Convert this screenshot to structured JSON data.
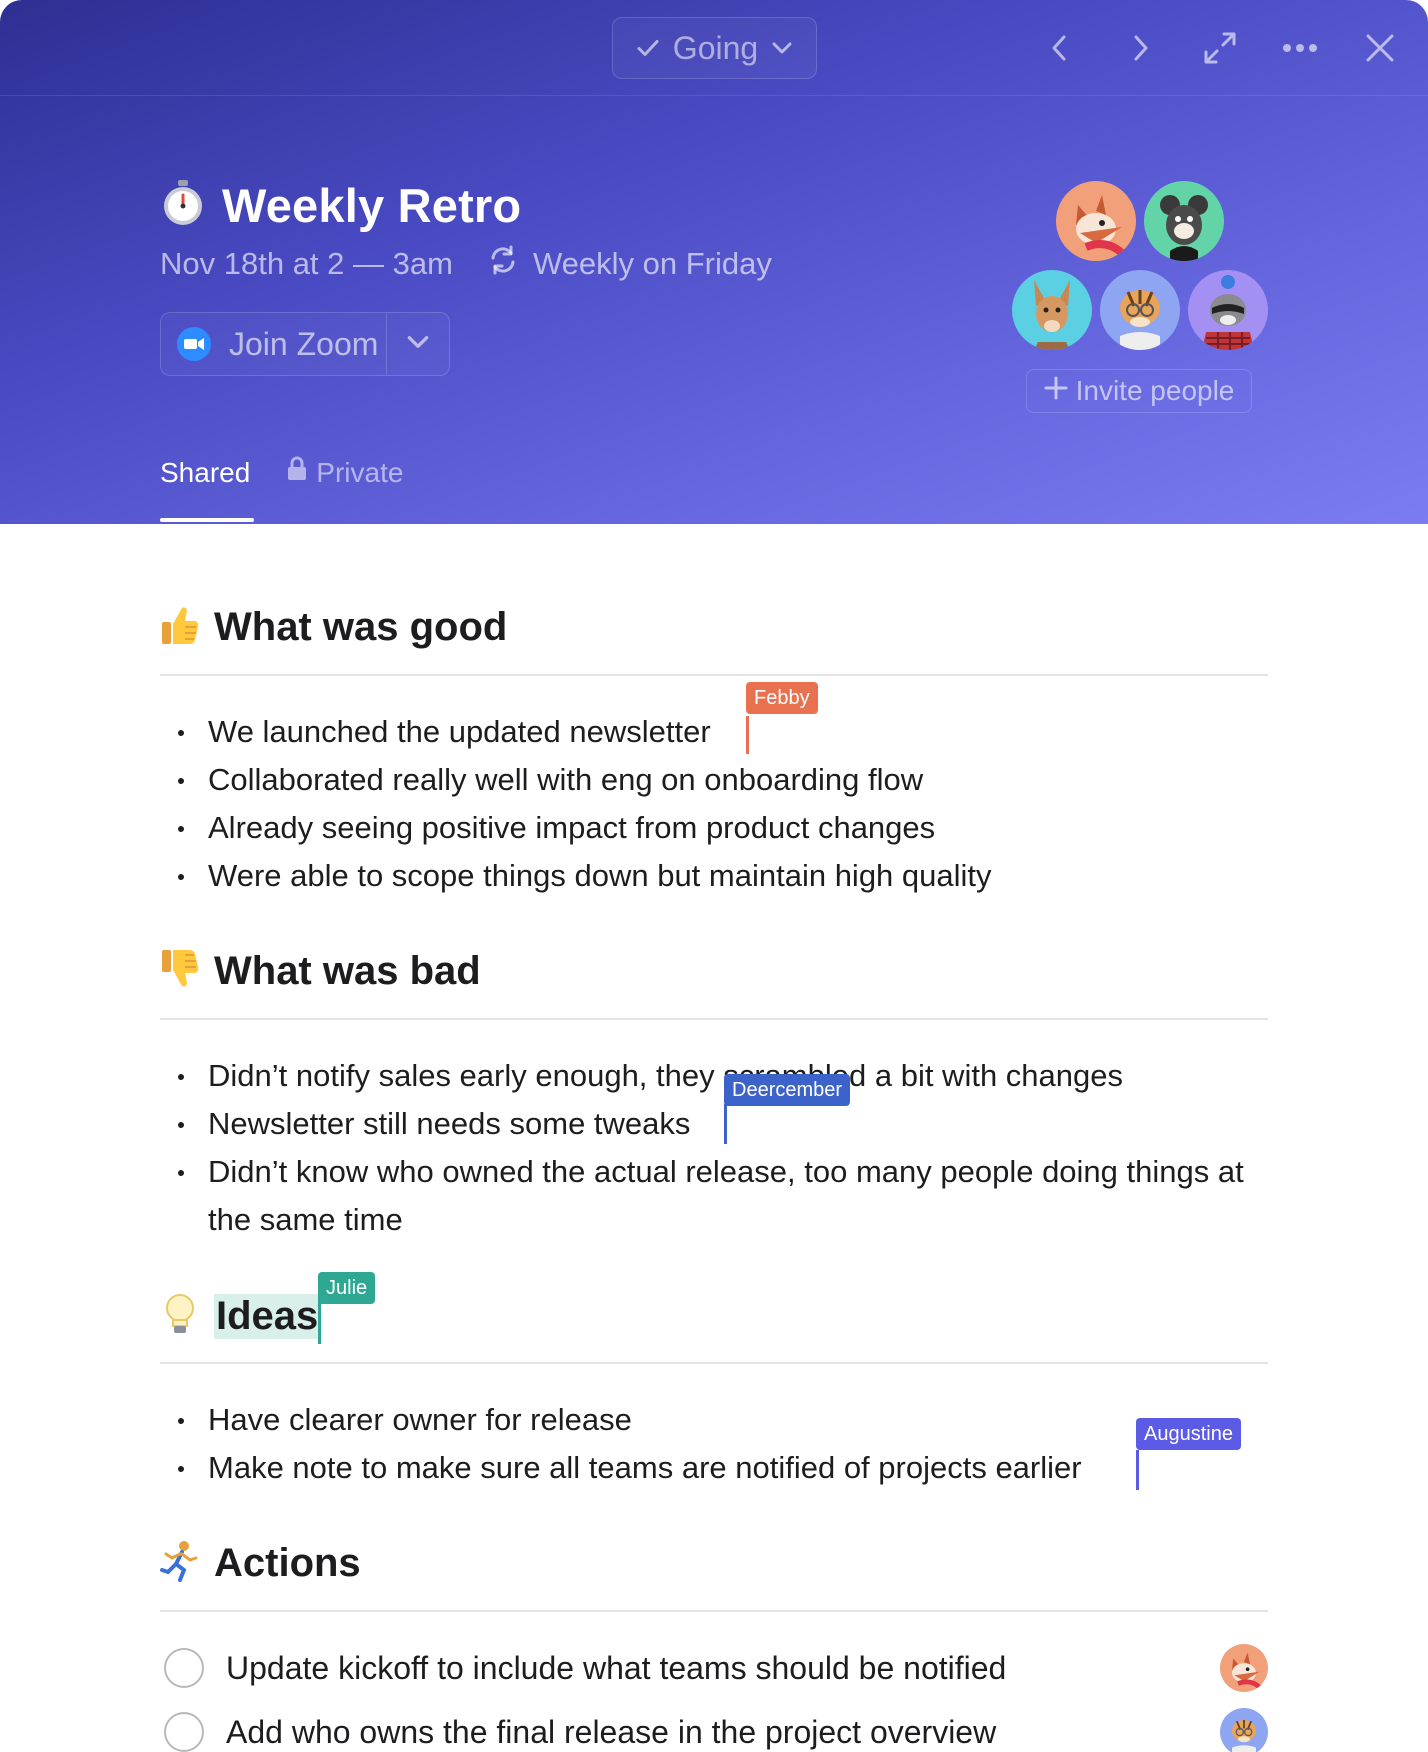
{
  "topbar": {
    "rsvp_label": "Going",
    "icons": [
      "check-icon",
      "chevron-down-icon",
      "chevron-left-icon",
      "chevron-right-icon",
      "expand-icon",
      "more-icon",
      "close-icon"
    ]
  },
  "event": {
    "emoji": "⏱️",
    "title": "Weekly Retro",
    "time": "Nov 18th at 2 — 3am",
    "recurrence": "Weekly on Friday",
    "join_label": "Join Zoom",
    "invite_label": "Invite people"
  },
  "tabs": [
    {
      "label": "Shared",
      "active": true
    },
    {
      "label": "Private",
      "active": false
    }
  ],
  "sections": {
    "good": {
      "emoji": "👍",
      "heading": "What was good",
      "items": [
        "We launched the updated newsletter",
        "Collaborated really well with eng on onboarding flow",
        "Already seeing positive impact from product changes",
        "Were able to scope things down but maintain high quality"
      ]
    },
    "bad": {
      "emoji": "👎",
      "heading": "What was bad",
      "items": [
        "Didn’t notify sales early enough, they scrambled a bit with changes",
        "Newsletter still needs some tweaks",
        "Didn’t know who owned the actual release, too many people doing things at the same time"
      ]
    },
    "ideas": {
      "emoji": "💡",
      "heading": "Ideas",
      "items": [
        "Have clearer owner for release",
        "Make note to make sure all teams are notified of projects earlier"
      ]
    },
    "actions": {
      "emoji": "🏃",
      "heading": "Actions",
      "items": [
        "Update kickoff to include what teams should be notified",
        "Add who owns the final release in the project overview"
      ]
    }
  },
  "collaborators": {
    "febby": {
      "name": "Febby",
      "color": "#e8714f"
    },
    "deercember": {
      "name": "Deercember",
      "color": "#3b63c9"
    },
    "julie": {
      "name": "Julie",
      "color": "#2fa893"
    },
    "augustine": {
      "name": "Augustine",
      "color": "#5b5be6"
    }
  }
}
